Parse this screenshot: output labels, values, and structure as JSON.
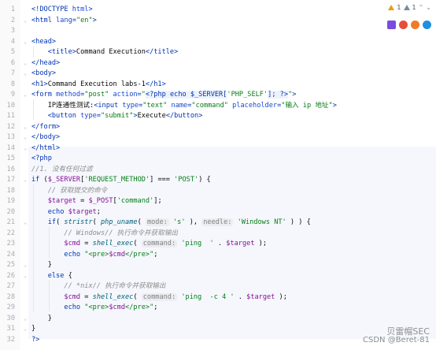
{
  "status": {
    "warnings": "1",
    "info": "1"
  },
  "browsers": [
    {
      "name": "phpstorm-icon",
      "color": "#7a4be0"
    },
    {
      "name": "chrome-icon",
      "color": "#e74c3c"
    },
    {
      "name": "firefox-icon",
      "color": "#f07a2a"
    },
    {
      "name": "edge-icon",
      "color": "#1f8fe0"
    }
  ],
  "watermark": {
    "line1": "贝雷帽SEC",
    "line2": "CSDN @Beret-81"
  },
  "lines": [
    {
      "n": "1",
      "s": [
        [
          "tag",
          "<!DOCTYPE "
        ],
        [
          "attr",
          "html"
        ],
        [
          "tag",
          ">"
        ]
      ]
    },
    {
      "n": "2",
      "s": [
        [
          "tag",
          "<html "
        ],
        [
          "attr",
          "lang"
        ],
        [
          "tag",
          "="
        ],
        [
          "str",
          "\"en\""
        ],
        [
          "tag",
          ">"
        ]
      ]
    },
    {
      "n": "3",
      "s": []
    },
    {
      "n": "4",
      "s": [
        [
          "tag",
          "<head>"
        ]
      ]
    },
    {
      "n": "5",
      "s": [
        [
          "",
          "    "
        ],
        [
          "tag",
          "<title>"
        ],
        [
          "",
          "Command Execution"
        ],
        [
          "tag",
          "</title>"
        ]
      ]
    },
    {
      "n": "6",
      "s": [
        [
          "tag",
          "</head>"
        ]
      ]
    },
    {
      "n": "7",
      "s": [
        [
          "tag",
          "<body>"
        ]
      ]
    },
    {
      "n": "8",
      "s": [
        [
          "tag",
          "<h1>"
        ],
        [
          "",
          "Command Execution labs-1"
        ],
        [
          "tag",
          "</h1>"
        ]
      ]
    },
    {
      "n": "9",
      "s": [
        [
          "tag",
          "<form "
        ],
        [
          "attr",
          "method"
        ],
        [
          "tag",
          "="
        ],
        [
          "str",
          "\"post\" "
        ],
        [
          "attr",
          "action"
        ],
        [
          "tag",
          "="
        ],
        [
          "str",
          "\""
        ],
        [
          "php",
          "<?php echo $_SERVER["
        ],
        [
          "str",
          "'PHP_SELF'"
        ],
        [
          "php",
          "]; ?>"
        ],
        [
          "str",
          "\""
        ],
        [
          "tag",
          ">"
        ]
      ]
    },
    {
      "n": "10",
      "s": [
        [
          "",
          "    IP连通性测试:"
        ],
        [
          "tag",
          "<input "
        ],
        [
          "attr",
          "type"
        ],
        [
          "tag",
          "="
        ],
        [
          "str",
          "\"text\" "
        ],
        [
          "attr",
          "name"
        ],
        [
          "tag",
          "="
        ],
        [
          "str",
          "\"command\" "
        ],
        [
          "attr",
          "placeholder"
        ],
        [
          "tag",
          "="
        ],
        [
          "str",
          "\"输入 ip 地址\""
        ],
        [
          "tag",
          ">"
        ]
      ]
    },
    {
      "n": "11",
      "s": [
        [
          "",
          "    "
        ],
        [
          "tag",
          "<button "
        ],
        [
          "attr",
          "type"
        ],
        [
          "tag",
          "="
        ],
        [
          "str",
          "\"submit\""
        ],
        [
          "tag",
          ">"
        ],
        [
          "",
          "Execute"
        ],
        [
          "tag",
          "</button>"
        ]
      ]
    },
    {
      "n": "12",
      "s": [
        [
          "tag",
          "</form>"
        ]
      ]
    },
    {
      "n": "13",
      "s": [
        [
          "tag",
          "</body>"
        ]
      ]
    },
    {
      "n": "14",
      "s": [
        [
          "tag",
          "</html>"
        ]
      ]
    },
    {
      "n": "15",
      "s": [
        [
          "kw",
          "<?php"
        ]
      ]
    },
    {
      "n": "16",
      "s": [
        [
          "cmt",
          "//1. 没有任何过滤"
        ]
      ]
    },
    {
      "n": "17",
      "s": [
        [
          "kw",
          "if "
        ],
        [
          "",
          "("
        ],
        [
          "var",
          "$_SERVER"
        ],
        [
          "",
          "["
        ],
        [
          "str",
          "'REQUEST_METHOD'"
        ],
        [
          "",
          "] === "
        ],
        [
          "str",
          "'POST'"
        ],
        [
          "",
          ") {"
        ]
      ]
    },
    {
      "n": "18",
      "s": [
        [
          "",
          "    "
        ],
        [
          "cmt",
          "// 获取提交的命令"
        ]
      ]
    },
    {
      "n": "19",
      "s": [
        [
          "",
          "    "
        ],
        [
          "var",
          "$target"
        ],
        [
          "",
          " = "
        ],
        [
          "var",
          "$_POST"
        ],
        [
          "",
          "["
        ],
        [
          "str",
          "'command'"
        ],
        [
          "",
          "];"
        ]
      ]
    },
    {
      "n": "20",
      "s": [
        [
          "",
          "    "
        ],
        [
          "kw",
          "echo "
        ],
        [
          "var",
          "$target"
        ],
        [
          "",
          ";"
        ]
      ]
    },
    {
      "n": "21",
      "s": [
        [
          "",
          "    "
        ],
        [
          "kw",
          "if"
        ],
        [
          "",
          "( "
        ],
        [
          "fn",
          "stristr"
        ],
        [
          "",
          "( "
        ],
        [
          "fn",
          "php_uname"
        ],
        [
          "",
          "( "
        ],
        [
          "hint",
          "mode:"
        ],
        [
          "",
          " "
        ],
        [
          "str",
          "'s'"
        ],
        [
          "",
          " ), "
        ],
        [
          "hint",
          "needle:"
        ],
        [
          "",
          " "
        ],
        [
          "str",
          "'Windows NT'"
        ],
        [
          "",
          " ) ) {"
        ]
      ]
    },
    {
      "n": "22",
      "s": [
        [
          "",
          "        "
        ],
        [
          "cmt",
          "// Windows// 执行命令并获取输出"
        ]
      ]
    },
    {
      "n": "23",
      "s": [
        [
          "",
          "        "
        ],
        [
          "var",
          "$cmd"
        ],
        [
          "",
          " = "
        ],
        [
          "fn",
          "shell_exec"
        ],
        [
          "",
          "( "
        ],
        [
          "hint",
          "command:"
        ],
        [
          "",
          " "
        ],
        [
          "str",
          "'ping  '"
        ],
        [
          "",
          " . "
        ],
        [
          "var",
          "$target"
        ],
        [
          "",
          " );"
        ]
      ]
    },
    {
      "n": "24",
      "s": [
        [
          "",
          "        "
        ],
        [
          "kw",
          "echo "
        ],
        [
          "str",
          "\"<pre>"
        ],
        [
          "var",
          "$cmd"
        ],
        [
          "str",
          "</pre>\""
        ],
        [
          "",
          ";"
        ]
      ]
    },
    {
      "n": "25",
      "s": [
        [
          "",
          "    }"
        ]
      ]
    },
    {
      "n": "26",
      "s": [
        [
          "",
          "    "
        ],
        [
          "kw",
          "else"
        ],
        [
          "",
          " {"
        ]
      ]
    },
    {
      "n": "27",
      "s": [
        [
          "",
          "        "
        ],
        [
          "cmt",
          "// *nix// 执行命令并获取输出"
        ]
      ]
    },
    {
      "n": "28",
      "s": [
        [
          "",
          "        "
        ],
        [
          "var",
          "$cmd"
        ],
        [
          "",
          " = "
        ],
        [
          "fn",
          "shell_exec"
        ],
        [
          "",
          "( "
        ],
        [
          "hint",
          "command:"
        ],
        [
          "",
          " "
        ],
        [
          "str",
          "'ping  -c 4 '"
        ],
        [
          "",
          " . "
        ],
        [
          "var",
          "$target"
        ],
        [
          "",
          " );"
        ]
      ]
    },
    {
      "n": "29",
      "s": [
        [
          "",
          "        "
        ],
        [
          "kw",
          "echo "
        ],
        [
          "str",
          "\"<pre>"
        ],
        [
          "var",
          "$cmd"
        ],
        [
          "str",
          "</pre>\""
        ],
        [
          "",
          ";"
        ]
      ]
    },
    {
      "n": "30",
      "s": [
        [
          "",
          "    }"
        ]
      ]
    },
    {
      "n": "31",
      "s": [
        [
          "",
          "}"
        ]
      ]
    },
    {
      "n": "32",
      "s": [
        [
          "kw",
          "?>"
        ]
      ]
    }
  ]
}
